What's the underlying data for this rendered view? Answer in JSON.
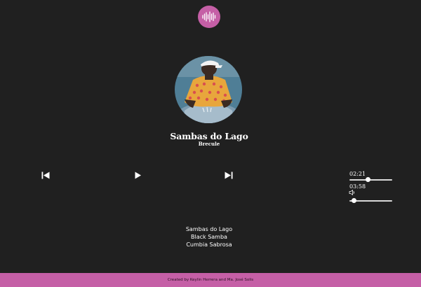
{
  "header": {
    "logo_icon": "sound-wave-icon",
    "accent_color": "#c55fa6"
  },
  "now_playing": {
    "title": "Sambas do Lago",
    "artist": "Brecule",
    "cover_icon": "album-cover-image"
  },
  "controls": {
    "prev_icon": "skip-previous-icon",
    "play_icon": "play-icon",
    "next_icon": "skip-next-icon"
  },
  "time": {
    "current": "02:21",
    "total": "03:58"
  },
  "progress": {
    "fraction": 0.43
  },
  "volume": {
    "icon": "volume-icon",
    "fraction": 0.05
  },
  "playlist": {
    "items": [
      {
        "label": "Sambas do Lago"
      },
      {
        "label": "Black Samba"
      },
      {
        "label": "Cumbia Sabrosa"
      }
    ]
  },
  "footer": {
    "credit": "Created by Keylin Herrera and Ma. José Solis"
  },
  "colors": {
    "background": "#202020",
    "footer": "#c55fa6",
    "text": "#ffffff"
  }
}
